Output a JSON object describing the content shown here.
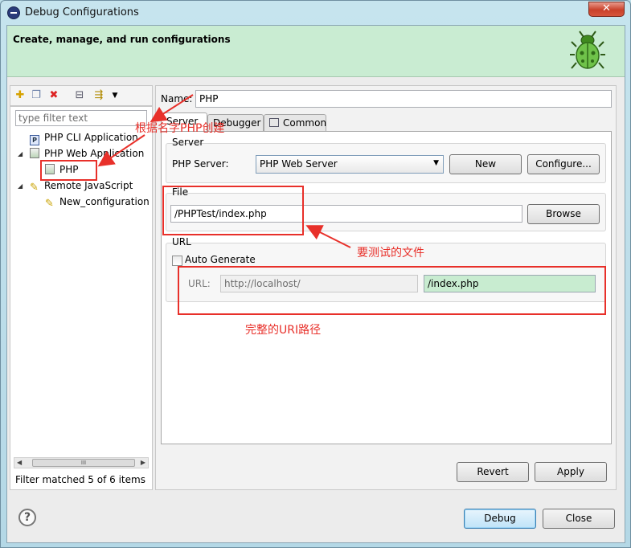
{
  "window": {
    "title": "Debug Configurations"
  },
  "banner": {
    "title": "Create, manage, and run configurations"
  },
  "left": {
    "filter_placeholder": "type filter text",
    "tree": [
      {
        "label": "PHP CLI Application",
        "icon": "php-icon"
      },
      {
        "label": "PHP Web Application",
        "icon": "php-web-icon"
      },
      {
        "label": "PHP",
        "icon": "php-launch-icon"
      },
      {
        "label": "Remote JavaScript",
        "icon": "javascript-icon"
      },
      {
        "label": "New_configuration",
        "icon": "javascript-launch-icon"
      }
    ],
    "scroll_thumb": "III",
    "status": "Filter matched 5 of 6 items"
  },
  "right": {
    "name_label": "Name:",
    "name_value": "PHP",
    "tabs": [
      "Server",
      "Debugger",
      "Common"
    ],
    "server_group": "Server",
    "php_server_label": "PHP Server:",
    "php_server_value": "PHP Web Server",
    "new_button": "New",
    "configure_button": "Configure...",
    "file_group": "File",
    "file_value": "/PHPTest/index.php",
    "browse_button": "Browse",
    "url_group": "URL",
    "auto_generate": "Auto Generate",
    "url_label": "URL:",
    "url_base": "http://localhost/",
    "url_path": "/index.php",
    "revert_button": "Revert",
    "apply_button": "Apply"
  },
  "footer": {
    "help": "?",
    "debug_button": "Debug",
    "close_button": "Close"
  },
  "annotations": {
    "php_name": "根据名字PHP创建",
    "file": "要测试的文件",
    "url": "完整的URI路径"
  },
  "colors": {
    "annotation": "#e8302a",
    "banner": "#c9ecd2",
    "highlight": "#c8ecd0"
  }
}
